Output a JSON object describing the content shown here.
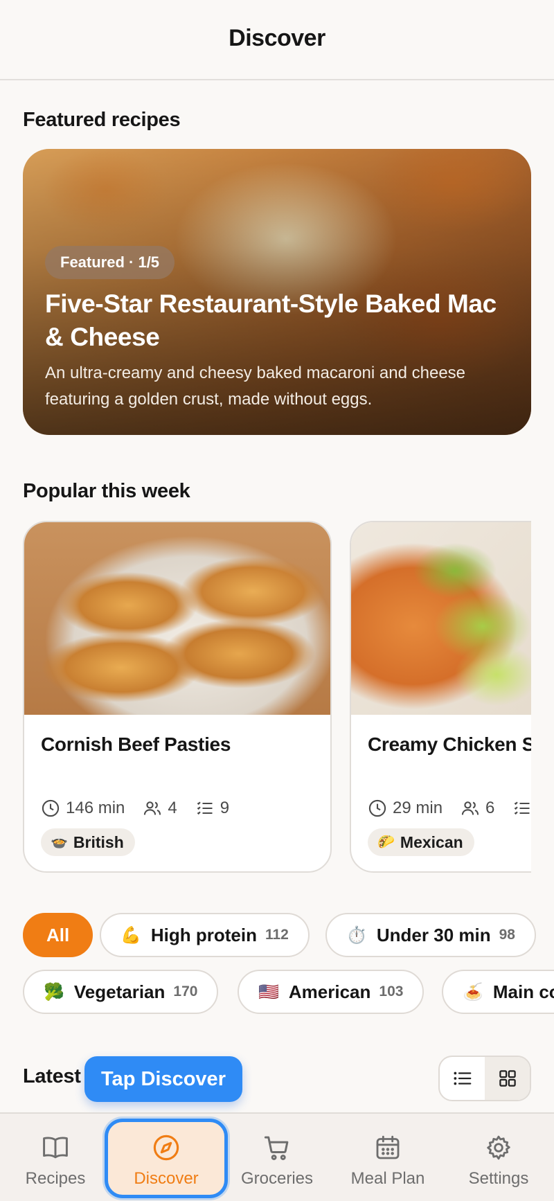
{
  "header": {
    "title": "Discover"
  },
  "featured": {
    "section_title": "Featured recipes",
    "badge": "Featured · 1/5",
    "title": "Five-Star Restaurant-Style Baked Mac & Cheese",
    "description": "An ultra-creamy and cheesy baked macaroni and cheese featuring a golden crust, made without eggs."
  },
  "popular": {
    "section_title": "Popular this week",
    "cards": [
      {
        "title": "Cornish Beef Pasties",
        "time": "146 min",
        "servings": "4",
        "ingredients": "9",
        "cuisine_flag": "🍲",
        "cuisine": "British"
      },
      {
        "title": "Creamy Chicken Soup",
        "time": "29 min",
        "servings": "6",
        "ingredients": "",
        "cuisine_flag": "🌮",
        "cuisine": "Mexican"
      }
    ]
  },
  "filters": [
    {
      "label": "All",
      "count": "",
      "emoji": "",
      "active": true
    },
    {
      "label": "High protein",
      "count": "112",
      "emoji": "💪"
    },
    {
      "label": "Under 30 min",
      "count": "98",
      "emoji": "⏱️"
    },
    {
      "label": "Vegetarian",
      "count": "170",
      "emoji": "🥦"
    },
    {
      "label": "American",
      "count": "103",
      "emoji": "🇺🇸"
    },
    {
      "label": "Main co",
      "count": "",
      "emoji": "🍝"
    }
  ],
  "latest": {
    "section_title": "Latest"
  },
  "tooltip": {
    "text": "Tap Discover"
  },
  "tabbar": {
    "items": [
      {
        "label": "Recipes",
        "icon": "book-icon"
      },
      {
        "label": "Discover",
        "icon": "compass-icon",
        "active": true
      },
      {
        "label": "Groceries",
        "icon": "cart-icon"
      },
      {
        "label": "Meal Plan",
        "icon": "calendar-icon"
      },
      {
        "label": "Settings",
        "icon": "gear-icon"
      }
    ]
  },
  "colors": {
    "accent": "#f07d14",
    "highlight": "#2f8bf5",
    "background": "#faf8f6"
  }
}
